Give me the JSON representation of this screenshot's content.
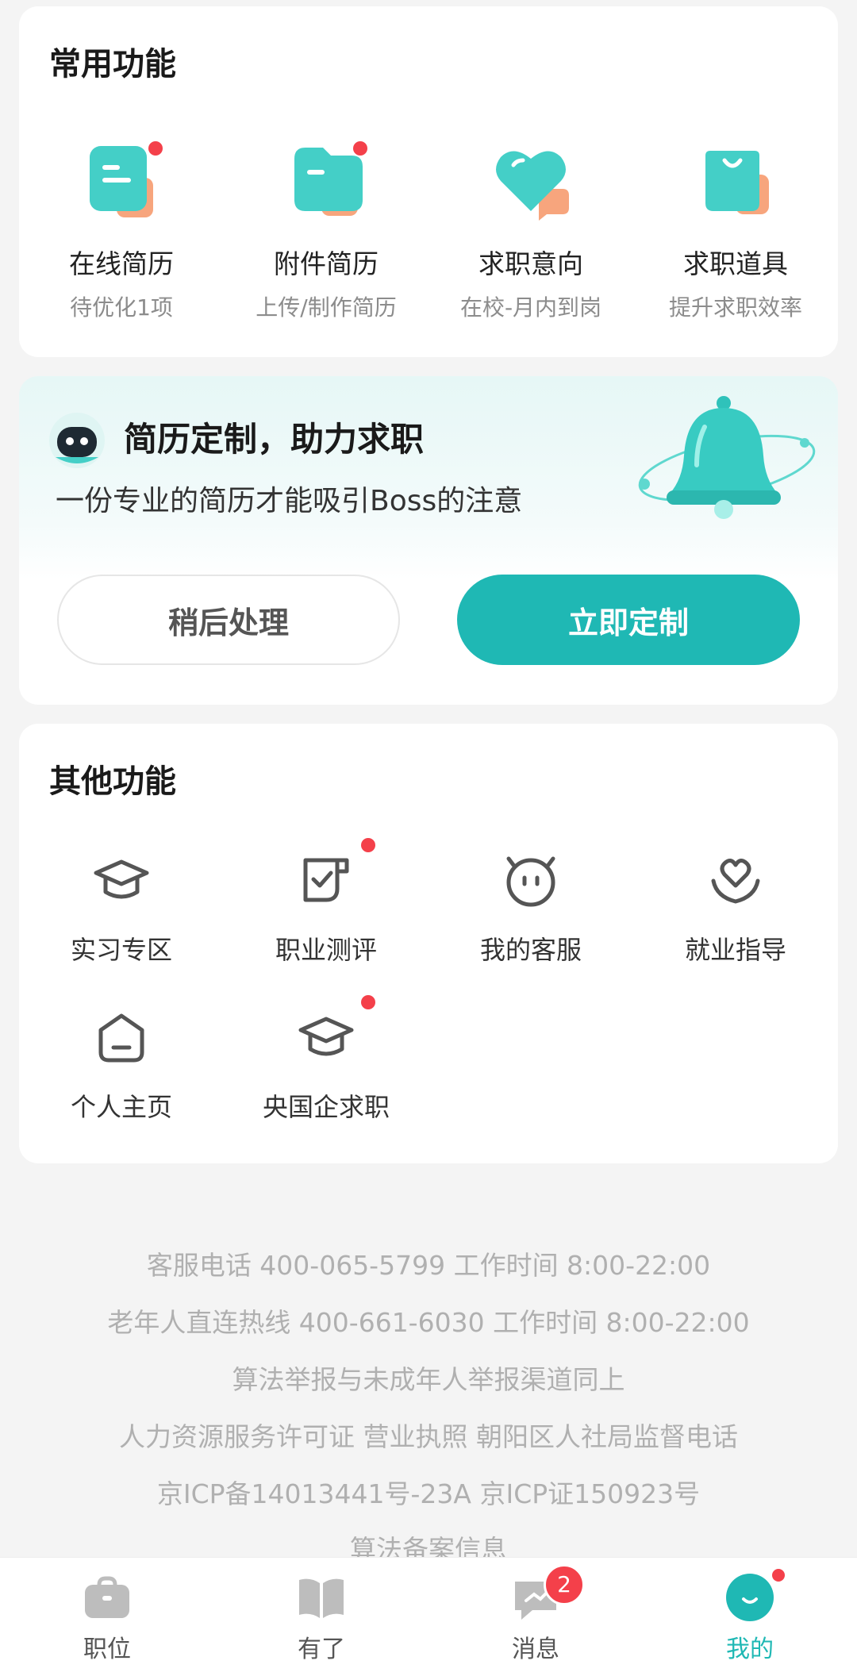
{
  "common": {
    "title": "常用功能",
    "items": [
      {
        "title": "在线简历",
        "sub": "待优化1项",
        "icon": "online-resume-icon"
      },
      {
        "title": "附件简历",
        "sub": "上传/制作简历",
        "icon": "attachment-resume-icon"
      },
      {
        "title": "求职意向",
        "sub": "在校-月内到岗",
        "icon": "heart-icon"
      },
      {
        "title": "求职道具",
        "sub": "提升求职效率",
        "icon": "shopping-bag-icon"
      }
    ]
  },
  "promo": {
    "title": "简历定制，助力求职",
    "subtitle": "一份专业的简历才能吸引Boss的注意",
    "later_label": "稍后处理",
    "now_label": "立即定制"
  },
  "other": {
    "title": "其他功能",
    "items": [
      {
        "label": "实习专区",
        "icon": "graduation-cap-icon"
      },
      {
        "label": "职业测评",
        "icon": "assessment-icon"
      },
      {
        "label": "我的客服",
        "icon": "customer-service-icon"
      },
      {
        "label": "就业指导",
        "icon": "guidance-icon"
      },
      {
        "label": "个人主页",
        "icon": "home-page-icon"
      },
      {
        "label": "央国企求职",
        "icon": "graduation-cap-icon"
      }
    ]
  },
  "footer": {
    "lines": [
      "客服电话 400-065-5799  工作时间 8:00-22:00",
      "老年人直连热线 400-661-6030 工作时间 8:00-22:00",
      "算法举报与未成年人举报渠道同上",
      "人力资源服务许可证   营业执照   朝阳区人社局监督电话",
      "京ICP备14013441号-23A   京ICP证150923号",
      "算法备案信息"
    ]
  },
  "tabbar": {
    "items": [
      {
        "label": "职位",
        "icon": "briefcase-icon"
      },
      {
        "label": "有了",
        "icon": "book-icon"
      },
      {
        "label": "消息",
        "icon": "message-icon",
        "badge": "2"
      },
      {
        "label": "我的",
        "icon": "profile-icon"
      }
    ]
  },
  "colors": {
    "accent": "#1fb8b4",
    "badge": "#f4404a"
  }
}
